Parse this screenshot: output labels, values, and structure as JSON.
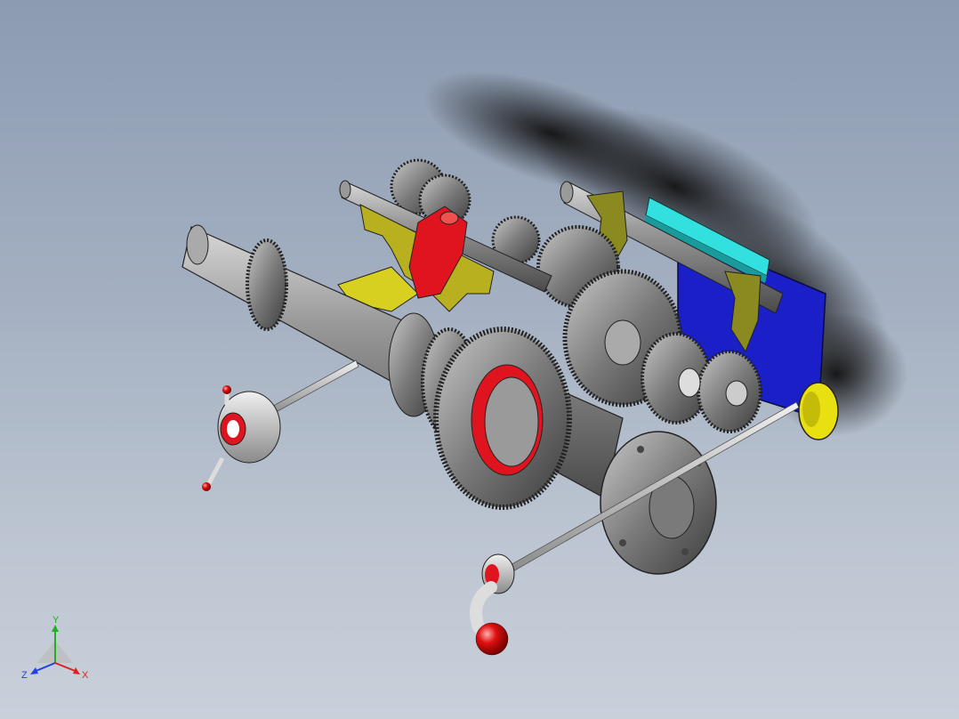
{
  "viewport": {
    "background_top": "#8c9bb2",
    "background_bottom": "#c9d0da"
  },
  "model": {
    "parts": [
      "main-spindle",
      "spindle-flange",
      "gear-cluster",
      "yellow-bracket",
      "red-fork-block",
      "blue-plate",
      "cyan-bar",
      "shift-rod",
      "handwheel-left",
      "crank-handle",
      "yellow-disc"
    ],
    "colors": {
      "steel": "#8a8a8a",
      "gear": "#6e6e6e",
      "bracket": "#b8b01e",
      "red_part": "#e0141e",
      "blue_plate": "#1a1fc8",
      "cyan_bar": "#33e0e0",
      "yellow_disc": "#e8e010",
      "shadow": "#1a1a1a"
    }
  },
  "triad": {
    "x_label": "X",
    "y_label": "Y",
    "z_label": "Z",
    "x_color": "#e02020",
    "y_color": "#20b020",
    "z_color": "#2040e0"
  }
}
